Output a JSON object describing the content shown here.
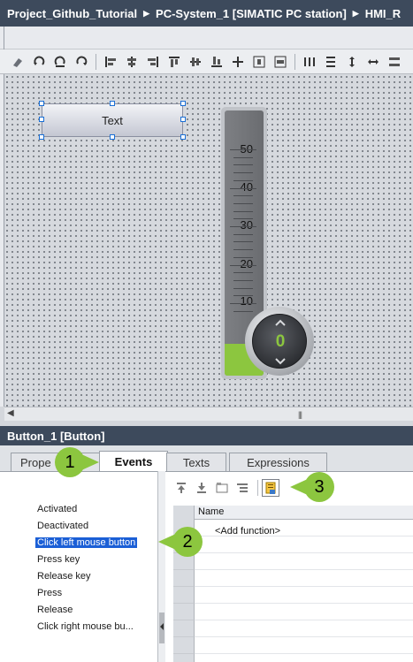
{
  "breadcrumb": {
    "items": [
      "Project_Github_Tutorial",
      "PC-System_1 [SIMATIC PC station]",
      "HMI_R"
    ],
    "separator": "▶"
  },
  "canvas": {
    "button_label": "Text",
    "gauge": {
      "labels": [
        "50",
        "40",
        "30",
        "20",
        "10"
      ],
      "value": "0",
      "fill_fraction": 0.12
    }
  },
  "scrollbar": {
    "left_arrow": "◀",
    "grip": "|||"
  },
  "inspector": {
    "title": "Button_1 [Button]",
    "tabs": [
      "Prope",
      "Events",
      "Texts",
      "Expressions"
    ],
    "active_tab": "Events"
  },
  "events": {
    "items": [
      "Activated",
      "Deactivated",
      "Click left mouse button",
      "Press key",
      "Release key",
      "Press",
      "Release",
      "Click right mouse bu..."
    ],
    "selected": "Click left mouse button"
  },
  "function_list": {
    "column_header": "Name",
    "add_function": "<Add function>"
  },
  "callouts": [
    "1",
    "2",
    "3"
  ],
  "colors": {
    "title_bar": "#3d4a5c",
    "accent_green": "#8cc63f",
    "selection_blue": "#1b5fd6"
  }
}
